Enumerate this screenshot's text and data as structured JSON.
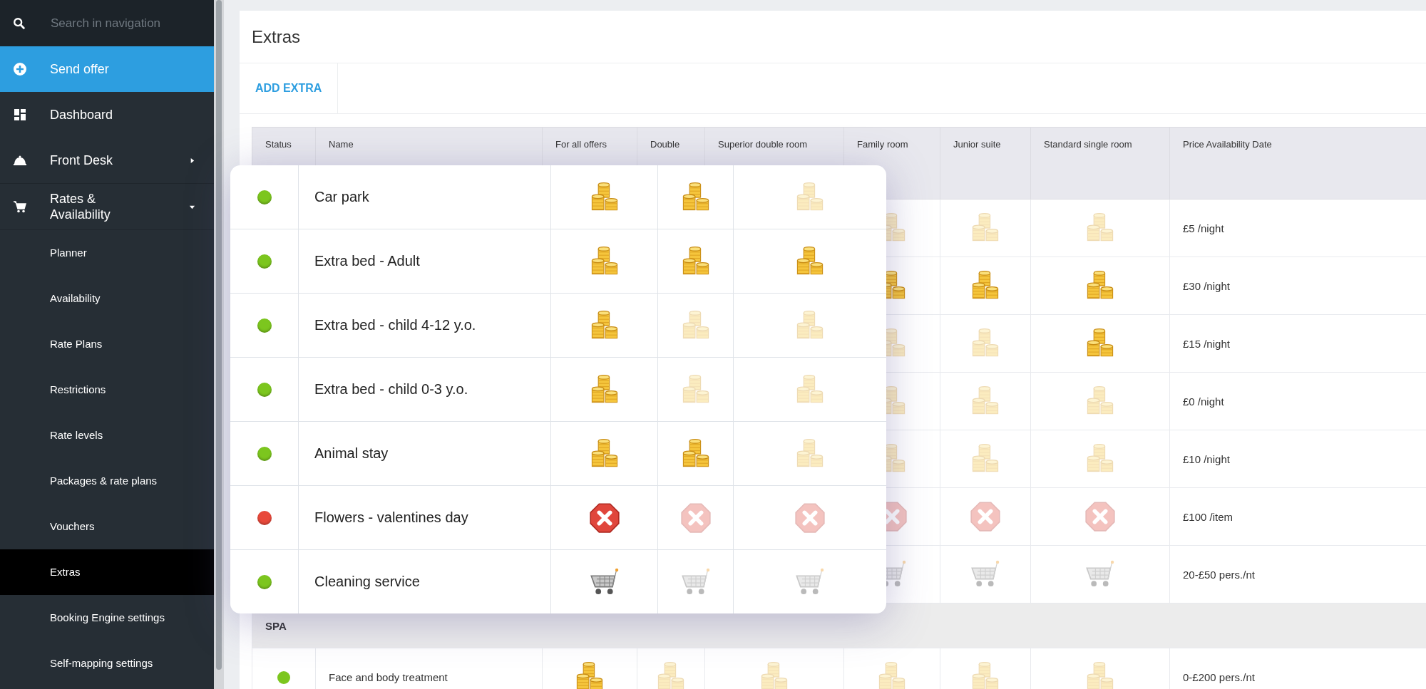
{
  "sidebar": {
    "search": {
      "placeholder": "Search in navigation"
    },
    "items": [
      {
        "label": "Send offer",
        "kind": "action",
        "selected": false
      },
      {
        "label": "Dashboard",
        "kind": "link",
        "selected": false
      },
      {
        "label": "Front Desk",
        "kind": "group",
        "expanded": false,
        "selected": false
      },
      {
        "label": "Rates & Availability",
        "kind": "group",
        "expanded": true,
        "selected": false,
        "children": [
          {
            "label": "Planner",
            "selected": false
          },
          {
            "label": "Availability",
            "selected": false
          },
          {
            "label": "Rate Plans",
            "selected": false
          },
          {
            "label": "Restrictions",
            "selected": false
          },
          {
            "label": "Rate levels",
            "selected": false
          },
          {
            "label": "Packages & rate plans",
            "selected": false
          },
          {
            "label": "Vouchers",
            "selected": false
          },
          {
            "label": "Extras",
            "selected": true
          },
          {
            "label": "Booking Engine settings",
            "selected": false
          },
          {
            "label": "Self-mapping settings",
            "selected": false
          }
        ]
      }
    ]
  },
  "panel": {
    "title": "Extras",
    "add_button": "ADD EXTRA"
  },
  "table": {
    "columns": [
      "Status",
      "Name",
      "For all offers",
      "Double",
      "Superior double room",
      "Family room",
      "Junior suite",
      "Standard single room",
      "Price Availability Date"
    ],
    "rows": [
      {
        "cells": [
          {
            "kind": "coins",
            "active": false
          },
          {
            "kind": "coins",
            "active": false
          },
          {
            "kind": "coins",
            "active": false
          }
        ],
        "price": "£5 /night"
      },
      {
        "cells": [
          {
            "kind": "coins",
            "active": true
          },
          {
            "kind": "coins",
            "active": true
          },
          {
            "kind": "coins",
            "active": true
          }
        ],
        "price": "£30 /night"
      },
      {
        "cells": [
          {
            "kind": "coins",
            "active": false
          },
          {
            "kind": "coins",
            "active": false
          },
          {
            "kind": "coins",
            "active": true
          }
        ],
        "price": "£15 /night"
      },
      {
        "cells": [
          {
            "kind": "coins",
            "active": false
          },
          {
            "kind": "coins",
            "active": false
          },
          {
            "kind": "coins",
            "active": false
          }
        ],
        "price": "£0 /night"
      },
      {
        "cells": [
          {
            "kind": "coins",
            "active": false
          },
          {
            "kind": "coins",
            "active": false
          },
          {
            "kind": "coins",
            "active": false
          }
        ],
        "price": "£10 /night"
      },
      {
        "cells": [
          {
            "kind": "cross",
            "active": false
          },
          {
            "kind": "cross",
            "active": false
          },
          {
            "kind": "cross",
            "active": false
          }
        ],
        "price": "£100 /item"
      },
      {
        "cells": [
          {
            "kind": "cart",
            "active": false
          },
          {
            "kind": "cart",
            "active": false
          },
          {
            "kind": "cart",
            "active": false
          }
        ],
        "price": "20-£50 pers./nt"
      }
    ],
    "group": "SPA",
    "group_rows": [
      {
        "color": "#7cc61e",
        "name": "Face and body treatment",
        "cells": [
          {
            "kind": "coins",
            "active": true
          },
          {
            "kind": "coins",
            "active": false
          },
          {
            "kind": "coins",
            "active": false
          },
          {
            "kind": "coins",
            "active": false
          },
          {
            "kind": "coins",
            "active": false
          },
          {
            "kind": "coins",
            "active": false
          }
        ],
        "price": "0-£200 pers./nt"
      }
    ]
  },
  "zoom_card": {
    "rows": [
      {
        "color": "#7cc61e",
        "name": "Car park",
        "cells": [
          {
            "kind": "coins",
            "active": true
          },
          {
            "kind": "coins",
            "active": true
          },
          {
            "kind": "coins",
            "active": false
          }
        ]
      },
      {
        "color": "#7cc61e",
        "name": "Extra bed - Adult",
        "cells": [
          {
            "kind": "coins",
            "active": true
          },
          {
            "kind": "coins",
            "active": true
          },
          {
            "kind": "coins",
            "active": true
          }
        ]
      },
      {
        "color": "#7cc61e",
        "name": "Extra bed - child 4-12 y.o.",
        "cells": [
          {
            "kind": "coins",
            "active": true
          },
          {
            "kind": "coins",
            "active": false
          },
          {
            "kind": "coins",
            "active": false
          }
        ]
      },
      {
        "color": "#7cc61e",
        "name": "Extra bed - child 0-3 y.o.",
        "cells": [
          {
            "kind": "coins",
            "active": true
          },
          {
            "kind": "coins",
            "active": false
          },
          {
            "kind": "coins",
            "active": false
          }
        ]
      },
      {
        "color": "#7cc61e",
        "name": "Animal stay",
        "cells": [
          {
            "kind": "coins",
            "active": true
          },
          {
            "kind": "coins",
            "active": true
          },
          {
            "kind": "coins",
            "active": false
          }
        ]
      },
      {
        "color": "#e8493b",
        "name": "Flowers - valentines day",
        "cells": [
          {
            "kind": "cross",
            "active": true
          },
          {
            "kind": "cross",
            "active": false
          },
          {
            "kind": "cross",
            "active": false
          }
        ]
      },
      {
        "color": "#7cc61e",
        "name": "Cleaning service",
        "cells": [
          {
            "kind": "cart",
            "active": true
          },
          {
            "kind": "cart",
            "active": false
          },
          {
            "kind": "cart",
            "active": false
          }
        ]
      }
    ]
  }
}
